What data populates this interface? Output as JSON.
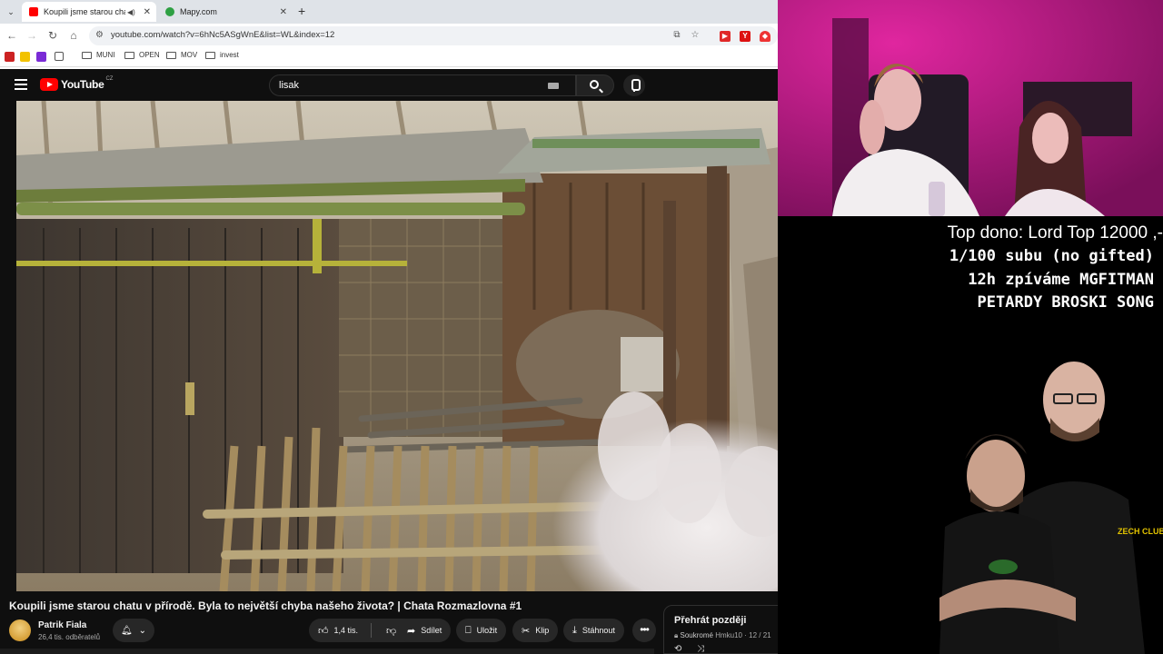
{
  "browser": {
    "tabs": [
      {
        "title": "Koupili jsme starou chatu v p",
        "active": true,
        "favicon": "youtube-icon"
      },
      {
        "title": "Mapy.com",
        "active": false,
        "favicon": "mapy-icon"
      }
    ],
    "url": "youtube.com/watch?v=6hNc5ASgWnE&list=WL&index=12",
    "bookmarks": [
      "MUNI",
      "OPEN",
      "MOV",
      "invest"
    ]
  },
  "youtube": {
    "logo_text": "YouTube",
    "country_code": "CZ",
    "search_value": "lisak",
    "video": {
      "title": "Koupili jsme starou chatu v přírodě. Byla to největší chyba našeho života? | Chata Rozmazlovna #1",
      "channel": "Patrik Fiala",
      "subscribers": "26,4 tis. odběratelů",
      "likes": "1,4 tis.",
      "actions": {
        "share": "Sdílet",
        "save": "Uložit",
        "clip": "Klip",
        "download": "Stáhnout"
      }
    },
    "playlist": {
      "title": "Přehrát později",
      "privacy": "Soukromé",
      "owner": "Hmku10",
      "position": "12 / 21"
    }
  },
  "stream_overlay": {
    "top_donation": "Top dono: Lord Top 12000 ,-",
    "goal": "1/100 subu (no gifted)",
    "line2": "12h zpíváme MGFITMAN",
    "line3": "PETARDY BROSKI SONG",
    "shirt_text": "ZECH CLUB"
  },
  "colors": {
    "yt_bg": "#0f0f0f",
    "yt_red": "#ff0000",
    "webcam_light": "#d01a9a"
  }
}
